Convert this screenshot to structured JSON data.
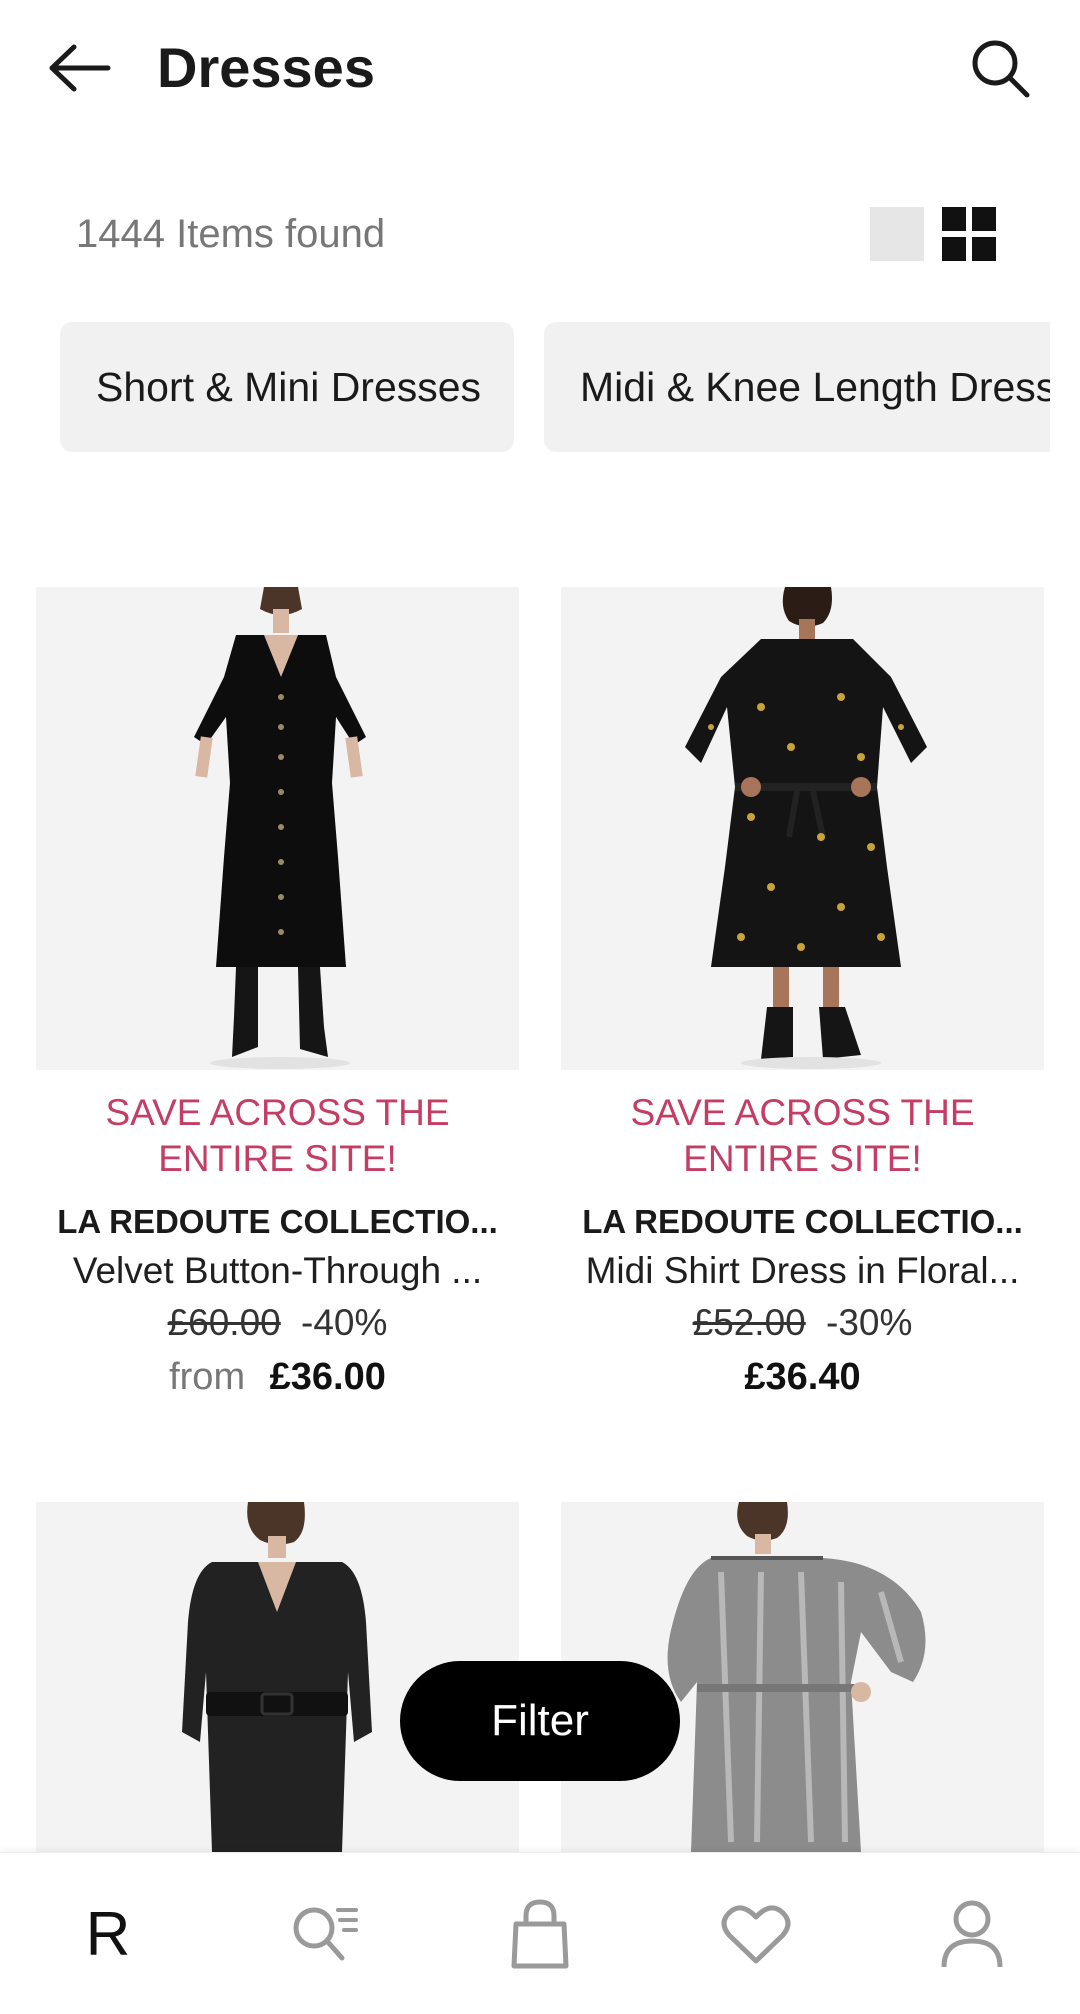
{
  "header": {
    "title": "Dresses",
    "back_icon": "arrow-left-icon",
    "search_icon": "search-icon"
  },
  "results": {
    "count_text": "1444 Items found",
    "view_single_icon": "single-view-icon",
    "view_grid_icon": "grid-view-icon"
  },
  "categories": [
    {
      "label": "Short & Mini Dresses"
    },
    {
      "label": "Midi & Knee Length Dresses"
    }
  ],
  "products": [
    {
      "promo_line1": "SAVE ACROSS THE",
      "promo_line2": "ENTIRE SITE!",
      "brand": "LA REDOUTE COLLECTIO...",
      "name": "Velvet Button-Through ...",
      "old_price": "£60.00",
      "discount": "-40%",
      "from_label": "from",
      "price": "£36.00"
    },
    {
      "promo_line1": "SAVE ACROSS THE",
      "promo_line2": "ENTIRE SITE!",
      "brand": "LA REDOUTE COLLECTIO...",
      "name": "Midi Shirt Dress in Floral...",
      "old_price": "£52.00",
      "discount": "-30%",
      "from_label": "",
      "price": "£36.40"
    }
  ],
  "filter": {
    "label": "Filter"
  },
  "bottom_nav": {
    "home_logo": "R",
    "items": [
      {
        "icon": "home-logo-icon"
      },
      {
        "icon": "search-categories-icon"
      },
      {
        "icon": "shopping-bag-icon"
      },
      {
        "icon": "heart-icon"
      },
      {
        "icon": "profile-icon"
      }
    ]
  },
  "colors": {
    "promo": "#c43d64",
    "chip_bg": "#f1f1f1",
    "image_bg": "#f3f3f3",
    "filter_bg": "#000000"
  }
}
